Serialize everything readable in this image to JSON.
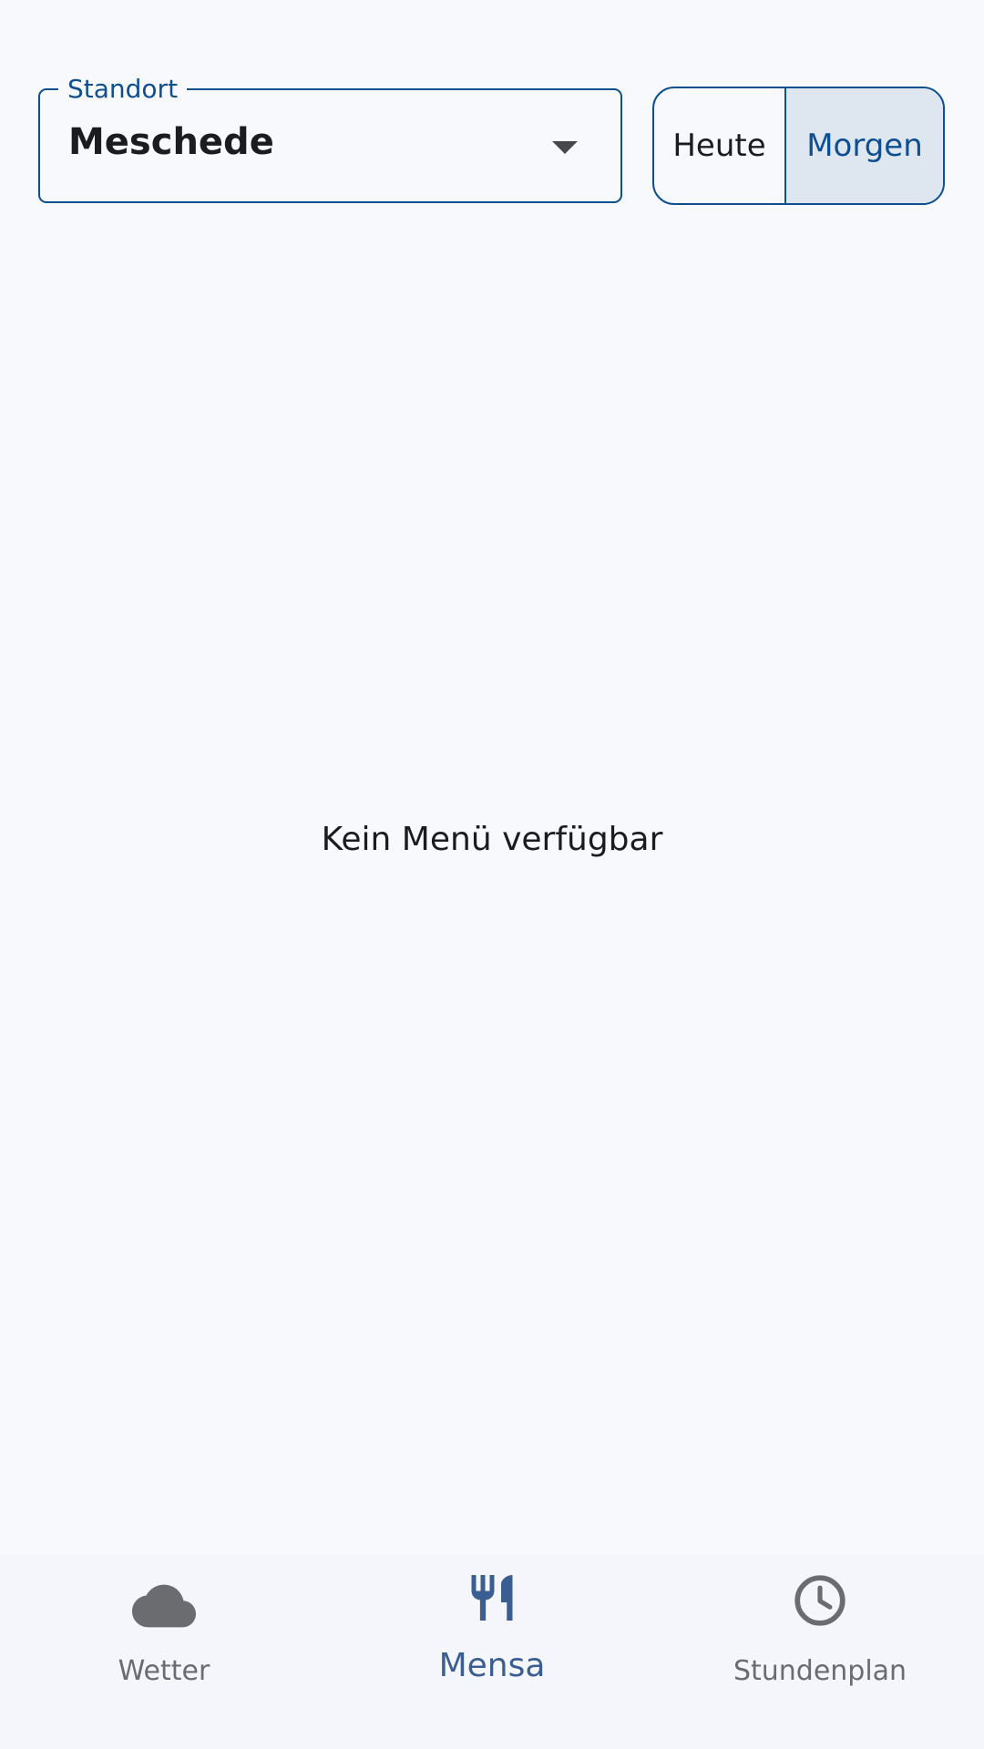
{
  "location": {
    "label": "Standort",
    "value": "Meschede"
  },
  "day_toggle": {
    "options": [
      "Heute",
      "Morgen"
    ],
    "selected": "Morgen"
  },
  "main": {
    "empty_message": "Kein Menü verfügbar"
  },
  "bottom_nav": {
    "items": [
      {
        "label": "Wetter",
        "icon": "cloud-icon"
      },
      {
        "label": "Mensa",
        "icon": "fork-knife-icon"
      },
      {
        "label": "Stundenplan",
        "icon": "clock-icon"
      }
    ],
    "active": "Mensa"
  },
  "colors": {
    "background": "#f7f9fc",
    "primary": "#0d4f91",
    "active_nav": "#3b5e92",
    "inactive_nav": "#6b6c70",
    "selected_segment": "#dee6f0"
  }
}
